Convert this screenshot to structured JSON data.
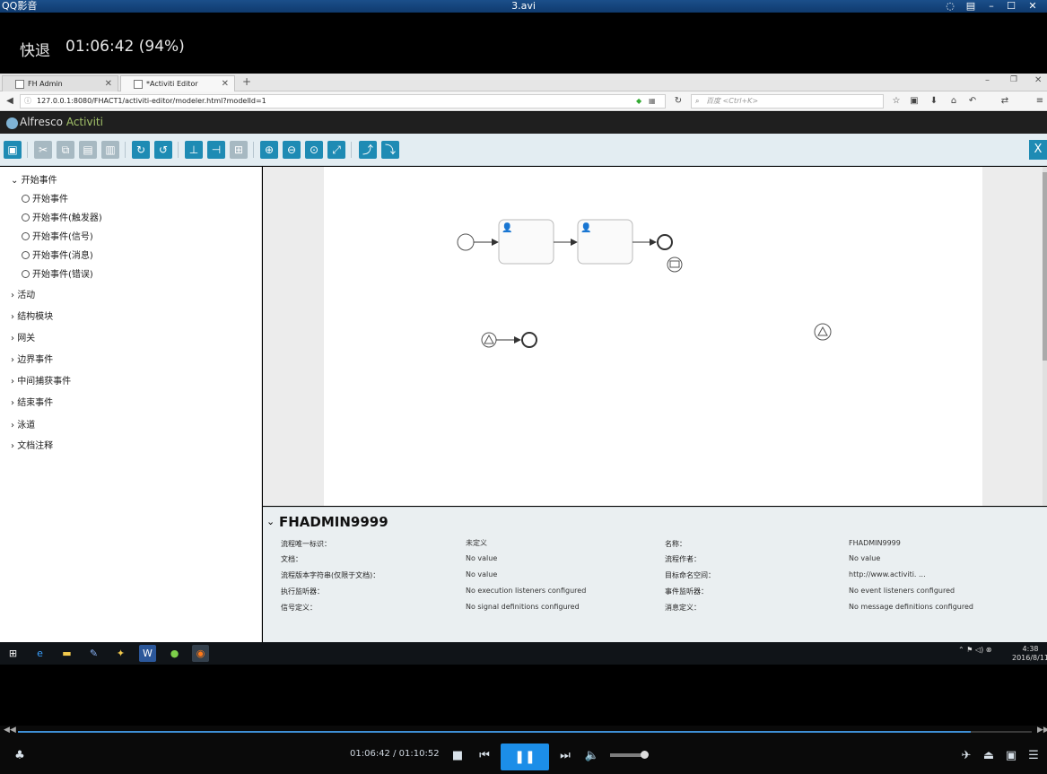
{
  "player": {
    "app_name": "QQ影音",
    "file_title": "3.avi",
    "osd_action": "快退",
    "osd_time": "01:06:42 (94%)",
    "time_display": "01:06:42 / 01:10:52",
    "progress_fraction": 0.94,
    "volume_fraction": 0.85
  },
  "browser": {
    "tabs": [
      {
        "label": "FH Admin"
      },
      {
        "label": "*Activiti Editor"
      }
    ],
    "new_tab": "+",
    "url": "127.0.0.1:8080/FHACT1/activiti-editor/modeler.html?modelId=1",
    "search_placeholder": "百度 <Ctrl+K>"
  },
  "editor": {
    "brand_part1": "Alfresco",
    "brand_part2": " Activiti",
    "close_label": "X",
    "palette": {
      "groups": [
        {
          "label": "开始事件",
          "expanded": true,
          "items": [
            "开始事件",
            "开始事件(触发器)",
            "开始事件(信号)",
            "开始事件(消息)",
            "开始事件(错误)"
          ]
        },
        {
          "label": "活动"
        },
        {
          "label": "结构模块"
        },
        {
          "label": "网关"
        },
        {
          "label": "边界事件"
        },
        {
          "label": "中间捕获事件"
        },
        {
          "label": "结束事件"
        },
        {
          "label": "泳道"
        },
        {
          "label": "文档注释"
        }
      ]
    },
    "properties": {
      "title": "FHADMIN9999",
      "left": [
        {
          "label": "流程唯一标识：",
          "value": "未定义"
        },
        {
          "label": "文档：",
          "value": "No value"
        },
        {
          "label": "流程版本字符串(仅限于文档)：",
          "value": "No value"
        },
        {
          "label": "执行监听器：",
          "value": "No execution listeners configured"
        },
        {
          "label": "信号定义：",
          "value": "No signal definitions configured"
        }
      ],
      "right": [
        {
          "label": "名称：",
          "value": "FHADMIN9999"
        },
        {
          "label": "流程作者：",
          "value": "No value"
        },
        {
          "label": "目标命名空间：",
          "value": "http://www.activiti. ..."
        },
        {
          "label": "事件监听器：",
          "value": "No event listeners configured"
        },
        {
          "label": "消息定义：",
          "value": "No message definitions configured"
        }
      ]
    }
  },
  "taskbar": {
    "clock_time": "4:38",
    "clock_date": "2016/8/11"
  },
  "colors": {
    "accent": "#1e8bb4",
    "player_blue": "#1c8ee8"
  }
}
